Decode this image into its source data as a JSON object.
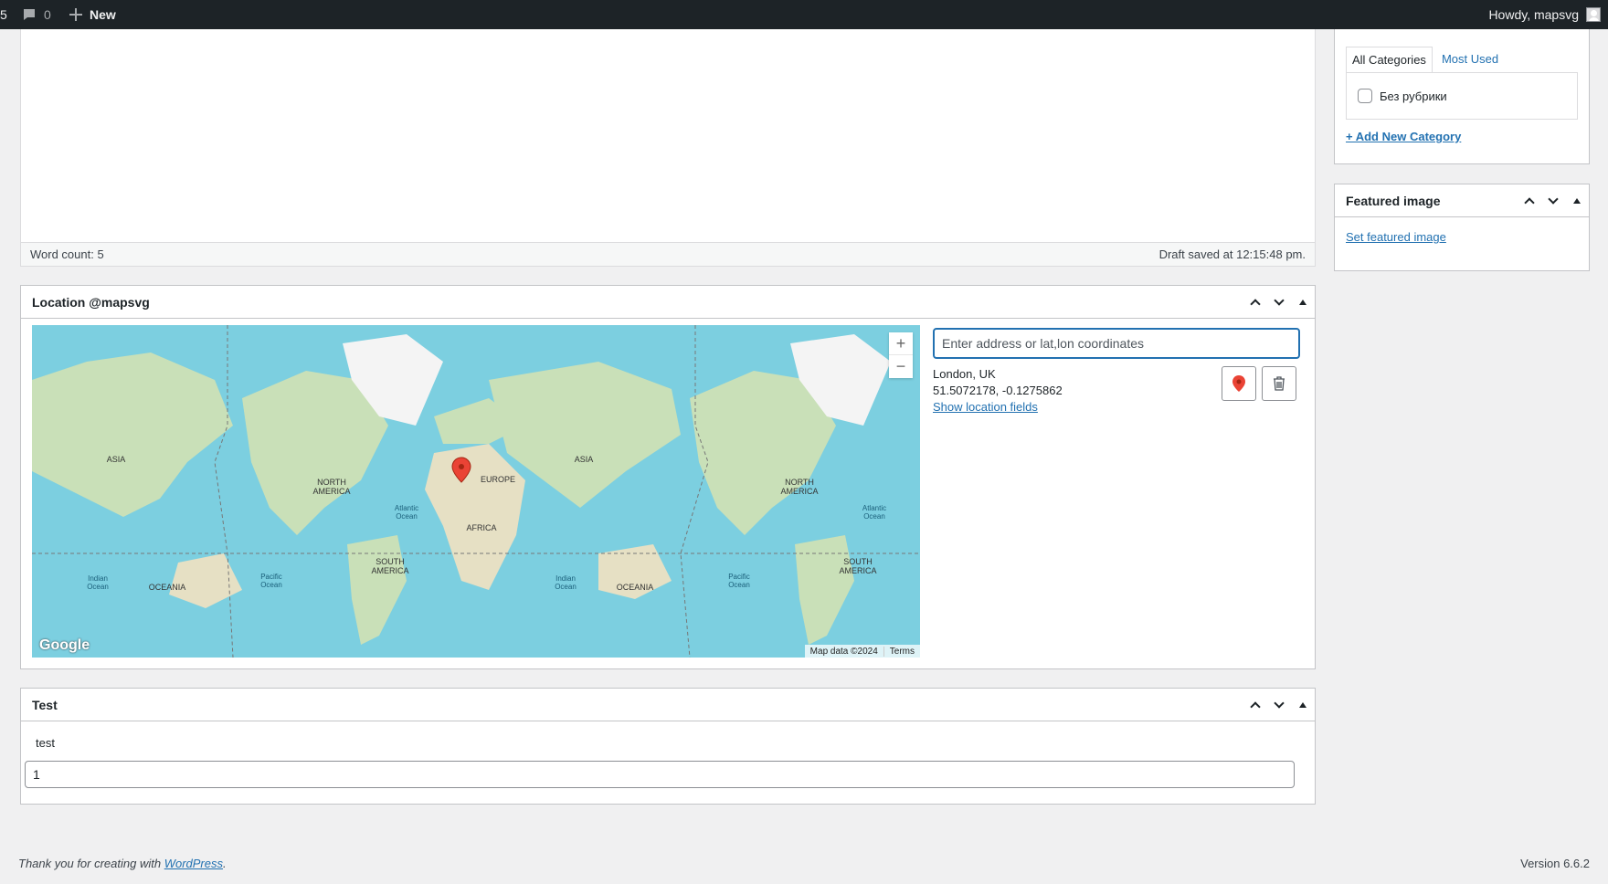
{
  "adminbar": {
    "updates_count": "5",
    "comments_count": "0",
    "new_label": "New",
    "greeting": "Howdy, mapsvg"
  },
  "editor": {
    "word_count": "Word count: 5",
    "draft_status": "Draft saved at 12:15:48 pm."
  },
  "location_box": {
    "title": "Location @mapsvg",
    "address_placeholder": "Enter address or lat,lon coordinates",
    "place_name": "London, UK",
    "coordinates": "51.5072178, -0.1275862",
    "show_fields_link": "Show location fields",
    "map": {
      "zoom_in": "+",
      "zoom_out": "−",
      "logo": "Google",
      "attribution": "Map data ©2024",
      "terms": "Terms",
      "labels": [
        "ASIA",
        "NORTH AMERICA",
        "EUROPE",
        "AFRICA",
        "SOUTH AMERICA",
        "OCEANIA",
        "Atlantic Ocean",
        "Indian Ocean",
        "Pacific Ocean"
      ]
    }
  },
  "test_box": {
    "title": "Test",
    "field_label": "test",
    "field_value": "1"
  },
  "categories_box": {
    "tab_all": "All Categories",
    "tab_most_used": "Most Used",
    "category_item": "Без рубрики",
    "add_new": "+ Add New Category"
  },
  "featured_image_box": {
    "title": "Featured image",
    "set_link": "Set featured image"
  },
  "footer": {
    "thanks_prefix": "Thank you for creating with ",
    "wordpress_link": "WordPress",
    "thanks_suffix": ".",
    "version": "Version 6.6.2"
  }
}
